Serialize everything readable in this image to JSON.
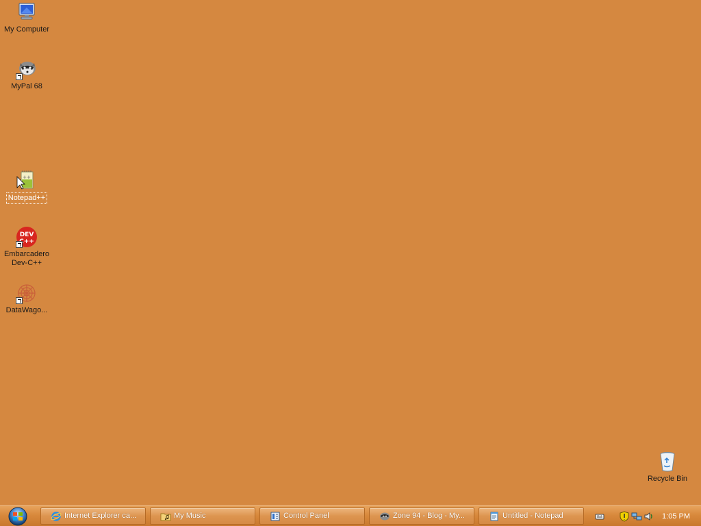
{
  "desktop": {
    "background_color": "#d58840",
    "icons": [
      {
        "label": "My Computer",
        "icon": "computer-icon"
      },
      {
        "label": "MyPal 68",
        "icon": "raccoon-icon"
      },
      {
        "label": "Notepad++",
        "icon": "notepad-plus-plus-icon"
      },
      {
        "label": "Embarcadero Dev-C++",
        "icon": "dev-cpp-icon"
      },
      {
        "label": "DataWago...",
        "icon": "datawagon-icon"
      },
      {
        "label": "Recycle Bin",
        "icon": "recycle-bin-icon"
      }
    ]
  },
  "taskbar": {
    "start_icon": "windows-orb-icon",
    "tasks": [
      {
        "label": "Internet Explorer ca...",
        "icon": "internet-explorer-icon"
      },
      {
        "label": "My Music",
        "icon": "folder-music-icon"
      },
      {
        "label": "Control Panel",
        "icon": "control-panel-icon"
      },
      {
        "label": "Zone 94 - Blog - My...",
        "icon": "raccoon-icon"
      },
      {
        "label": "Untitled - Notepad",
        "icon": "notepad-icon"
      }
    ],
    "tray": {
      "icons": [
        "keyboard-icon",
        "security-shield-icon",
        "network-icon",
        "volume-icon"
      ],
      "clock": "1:05 PM"
    }
  }
}
